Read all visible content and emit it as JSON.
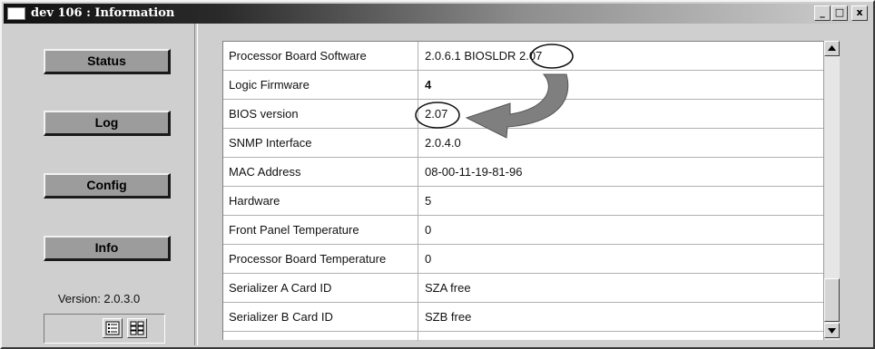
{
  "window": {
    "title": "dev 106 : Information",
    "controls": {
      "minimize": "_",
      "maximize": "□",
      "close": "x"
    }
  },
  "nav": {
    "items": [
      {
        "label": "Status"
      },
      {
        "label": "Log"
      },
      {
        "label": "Config"
      },
      {
        "label": "Info"
      }
    ],
    "version_label": "Version: 2.0.3.0",
    "view_buttons": [
      "list-view-icon",
      "grid-view-icon"
    ]
  },
  "info_table": {
    "rows": [
      {
        "label": "Processor Board Software",
        "value": "2.0.6.1 BIOSLDR 2.07"
      },
      {
        "label": "Logic Firmware",
        "value": "4"
      },
      {
        "label": "BIOS version",
        "value": "2.07"
      },
      {
        "label": "SNMP Interface",
        "value": "2.0.4.0"
      },
      {
        "label": "MAC Address",
        "value": "08-00-11-19-81-96"
      },
      {
        "label": "Hardware",
        "value": "5"
      },
      {
        "label": "Front Panel Temperature",
        "value": "0"
      },
      {
        "label": "Processor Board Temperature",
        "value": "0"
      },
      {
        "label": "Serializer A Card ID",
        "value": "SZA free"
      },
      {
        "label": "Serializer B Card ID",
        "value": "SZB free"
      }
    ]
  },
  "scrollbar": {
    "up_icon": "scroll-up-arrow-icon",
    "down_icon": "scroll-down-arrow-icon"
  },
  "annotation": {
    "arrow_color": "#7f7f7f",
    "circle_color": "#111111"
  }
}
